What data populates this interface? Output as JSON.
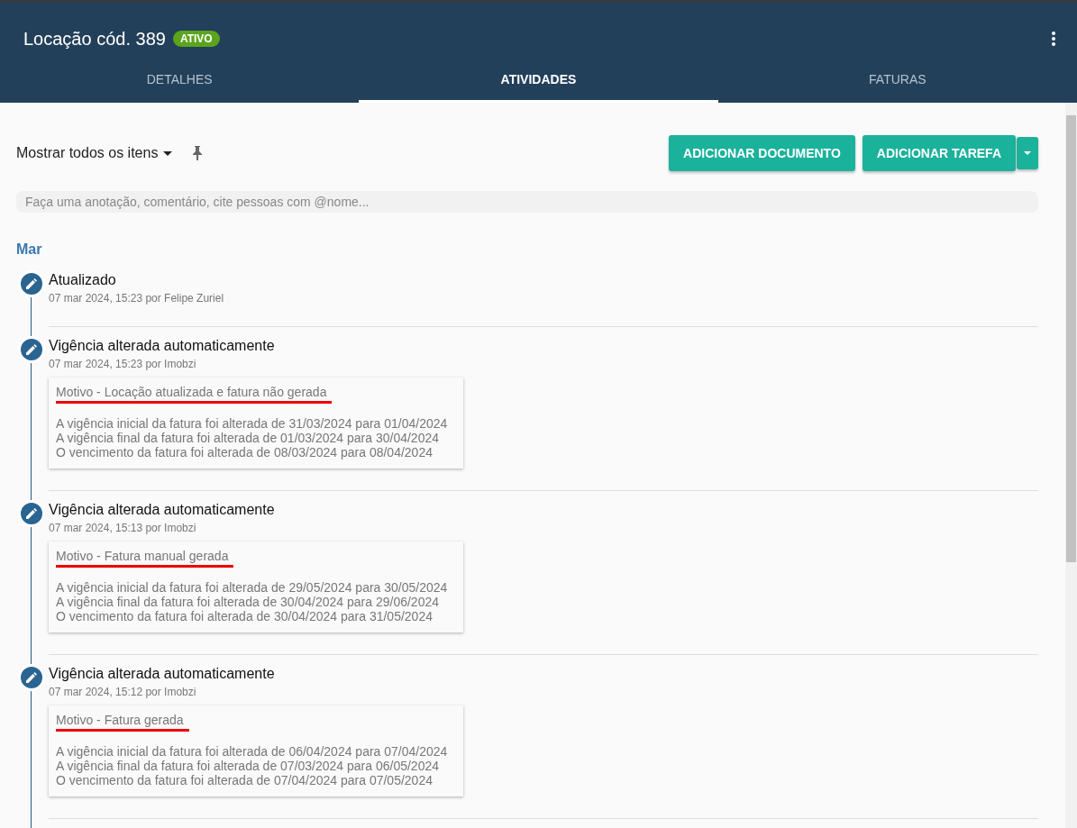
{
  "header": {
    "title": "Locação cód. 389",
    "badge": "ATIVO"
  },
  "tabs": [
    {
      "label": "DETALHES",
      "selected": false
    },
    {
      "label": "ATIVIDADES",
      "selected": true
    },
    {
      "label": "FATURAS",
      "selected": false
    }
  ],
  "toolbar": {
    "filter": "Mostrar todos os itens",
    "buttons": [
      "ADICIONAR DOCUMENTO",
      "ADICIONAR TAREFA"
    ]
  },
  "comment": {
    "placeholder": "Faça uma anotação, comentário, cite pessoas com @nome..."
  },
  "month": "Mar",
  "activities": [
    {
      "title": "Atualizado",
      "meta": "07 mar 2024, 15:23 por Felipe Zuriel"
    },
    {
      "title": "Vigência alterada automaticamente",
      "meta": "07 mar 2024, 15:23 por Imobzi",
      "note": {
        "reason": "Motivo - Locação atualizada e fatura não gerada",
        "underlined": true,
        "lines": [
          "A vigência inicial da fatura foi alterada de 31/03/2024 para 01/04/2024",
          "A vigência final da fatura foi alterada de 01/03/2024 para 30/04/2024",
          "O vencimento da fatura foi alterada de 08/03/2024 para 08/04/2024"
        ]
      }
    },
    {
      "title": "Vigência alterada automaticamente",
      "meta": "07 mar 2024, 15:13 por Imobzi",
      "note": {
        "reason": "Motivo - Fatura manual gerada",
        "underlined": true,
        "lines": [
          "A vigência inicial da fatura foi alterada de 29/05/2024 para 30/05/2024",
          "A vigência final da fatura foi alterada de 30/04/2024 para 29/06/2024",
          "O vencimento da fatura foi alterada de 30/04/2024 para 31/05/2024"
        ]
      }
    },
    {
      "title": "Vigência alterada automaticamente",
      "meta": "07 mar 2024, 15:12 por Imobzi",
      "note": {
        "reason": "Motivo - Fatura gerada",
        "underlined": true,
        "lines": [
          "A vigência inicial da fatura foi alterada de 06/04/2024 para 07/04/2024",
          "A vigência final da fatura foi alterada de 07/03/2024 para 06/05/2024",
          "O vencimento da fatura foi alterada de 07/04/2024 para 07/05/2024"
        ]
      }
    }
  ]
}
